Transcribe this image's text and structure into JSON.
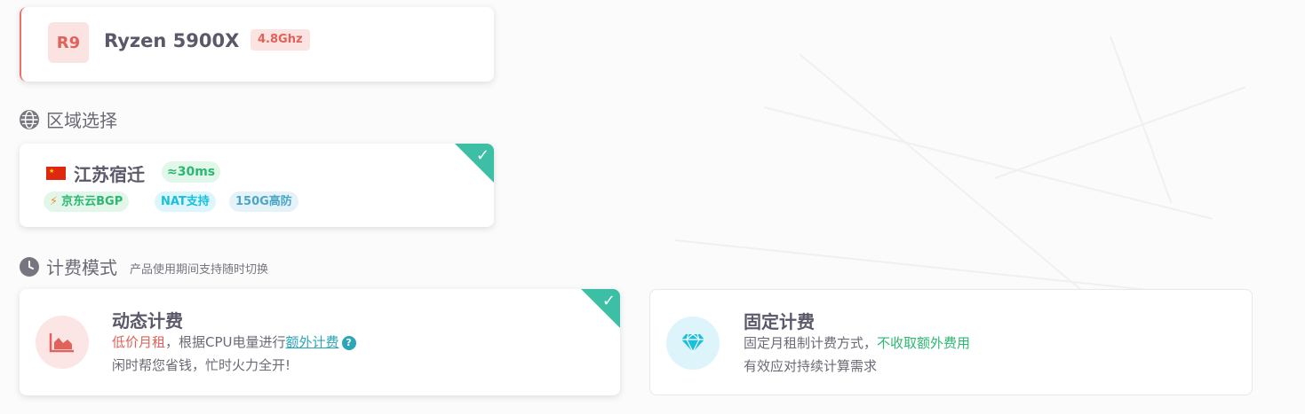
{
  "cpu": {
    "badge": "R9",
    "name": "Ryzen 5900X",
    "frequency": "4.8Ghz"
  },
  "region_section": {
    "title": "区域选择",
    "icon": "globe-icon"
  },
  "region": {
    "flag": "china-flag",
    "name": "江苏宿迁",
    "ping": "≈30ms",
    "tags": [
      "京东云BGP",
      "NAT支持",
      "150G高防"
    ],
    "selected": true
  },
  "billing_section": {
    "title": "计费模式",
    "subtitle": "产品使用期间支持随时切换",
    "icon": "clock-icon"
  },
  "billing": {
    "dynamic": {
      "title": "动态计费",
      "line1_highlight": "低价月租",
      "line1_text": "，根据CPU电量进行",
      "line1_link": "额外计费",
      "help": "?",
      "line2": "闲时帮您省钱，忙时火力全开!",
      "icon": "chart-area-icon",
      "selected": true
    },
    "fixed": {
      "title": "固定计费",
      "line1_text": "固定月租制计费方式，",
      "line1_highlight": "不收取额外费用",
      "line2": "有效应对持续计算需求",
      "icon": "diamond-icon",
      "selected": false
    }
  },
  "colors": {
    "accent_red": "#e0625a",
    "accent_green": "#2cb871",
    "accent_teal": "#3cbfa4",
    "accent_cyan": "#19bfdc"
  }
}
